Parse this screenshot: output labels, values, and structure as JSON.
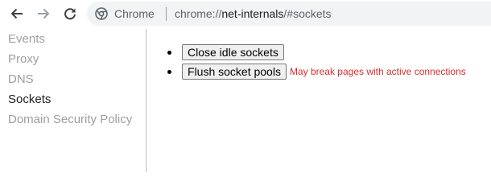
{
  "browser": {
    "chip_label": "Chrome",
    "url_scheme": "chrome://",
    "url_host": "net-internals",
    "url_path": "/#sockets"
  },
  "sidebar": {
    "items": [
      {
        "label": "Events"
      },
      {
        "label": "Proxy"
      },
      {
        "label": "DNS"
      },
      {
        "label": "Sockets",
        "selected": true
      },
      {
        "label": "Domain Security Policy"
      }
    ]
  },
  "sockets": {
    "close_idle_label": "Close idle sockets",
    "flush_pools_label": "Flush socket pools",
    "flush_warning": "May break pages with active connections"
  },
  "colors": {
    "warning": "#d32f2f",
    "selected_tab": "#202124",
    "unselected_tab": "#9e9e9e"
  },
  "icons": [
    "back-arrow-icon",
    "forward-arrow-icon",
    "reload-icon",
    "chrome-logo-icon"
  ]
}
